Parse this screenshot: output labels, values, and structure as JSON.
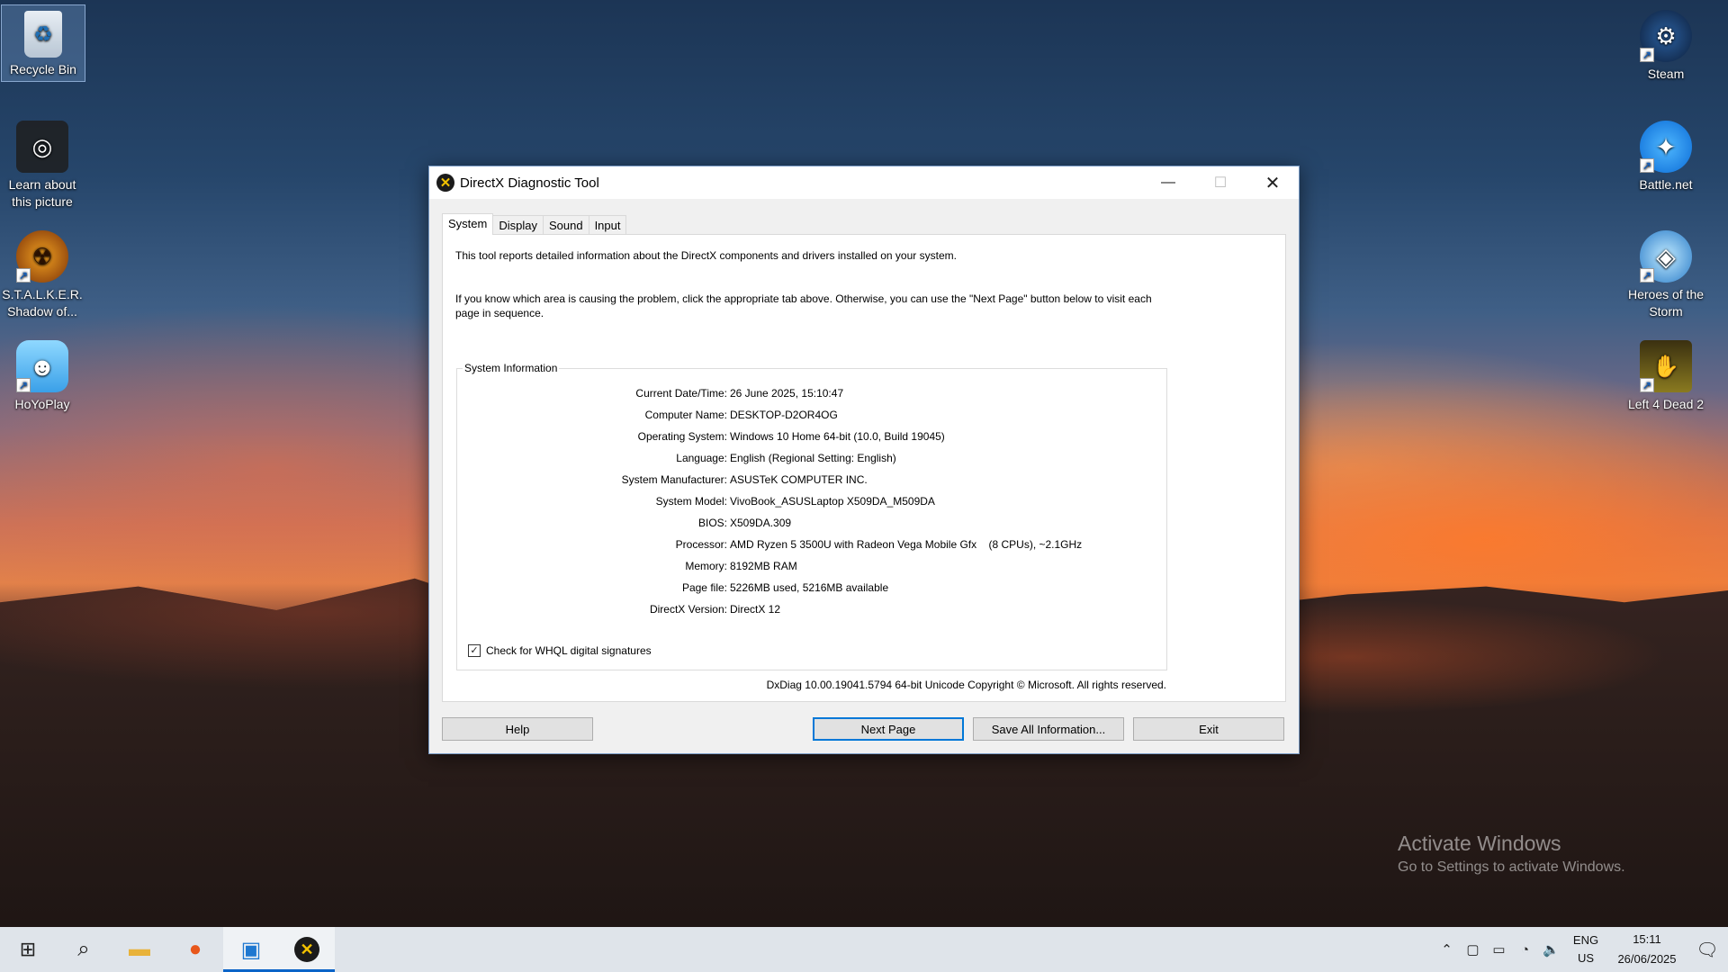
{
  "desktop": {
    "left_icons": [
      {
        "label": "Recycle Bin",
        "icon": "recycle-bin-icon"
      },
      {
        "label": "Learn about this picture",
        "icon": "camera-icon"
      },
      {
        "label": "S.T.A.L.K.E.R. Shadow of...",
        "icon": "stalker-game-icon"
      },
      {
        "label": "HoYoPlay",
        "icon": "hoyoplay-icon"
      }
    ],
    "right_icons": [
      {
        "label": "Steam",
        "icon": "steam-icon"
      },
      {
        "label": "Battle.net",
        "icon": "battlenet-icon"
      },
      {
        "label": "Heroes of the Storm",
        "icon": "heroes-of-the-storm-icon"
      },
      {
        "label": "Left 4 Dead 2",
        "icon": "left4dead2-icon"
      }
    ]
  },
  "window": {
    "title": "DirectX Diagnostic Tool",
    "tabs": [
      "System",
      "Display",
      "Sound",
      "Input"
    ],
    "active_tab": "System",
    "intro_1": "This tool reports detailed information about the DirectX components and drivers installed on your system.",
    "intro_2": "If you know which area is causing the problem, click the appropriate tab above.  Otherwise, you can use the \"Next Page\" button below to visit each page in sequence.",
    "group_title": "System Information",
    "rows": [
      {
        "label": "Current Date/Time:",
        "value": "26 June 2025, 15:10:47"
      },
      {
        "label": "Computer Name:",
        "value": "DESKTOP-D2OR4OG"
      },
      {
        "label": "Operating System:",
        "value": "Windows 10 Home 64-bit (10.0, Build 19045)"
      },
      {
        "label": "Language:",
        "value": "English (Regional Setting: English)"
      },
      {
        "label": "System Manufacturer:",
        "value": "ASUSTeK COMPUTER INC."
      },
      {
        "label": "System Model:",
        "value": "VivoBook_ASUSLaptop X509DA_M509DA"
      },
      {
        "label": "BIOS:",
        "value": "X509DA.309"
      },
      {
        "label": "Processor:",
        "value": "AMD Ryzen 5 3500U with Radeon Vega Mobile Gfx    (8 CPUs), ~2.1GHz"
      },
      {
        "label": "Memory:",
        "value": "8192MB RAM"
      },
      {
        "label": "Page file:",
        "value": "5226MB used, 5216MB available"
      },
      {
        "label": "DirectX Version:",
        "value": "DirectX 12"
      }
    ],
    "whql_label": "Check for WHQL digital signatures",
    "whql_checked": true,
    "footer": "DxDiag 10.00.19041.5794 64-bit Unicode  Copyright © Microsoft. All rights reserved.",
    "buttons": {
      "help": "Help",
      "next": "Next Page",
      "save": "Save All Information...",
      "exit": "Exit"
    }
  },
  "watermark": {
    "line1": "Activate Windows",
    "line2": "Go to Settings to activate Windows."
  },
  "taskbar": {
    "apps": [
      "start-icon",
      "search-icon",
      "file-explorer-icon",
      "firefox-icon",
      "photos-icon",
      "directx-icon"
    ],
    "lang": "ENG",
    "region": "US",
    "time": "15:11",
    "date": "26/06/2025"
  }
}
